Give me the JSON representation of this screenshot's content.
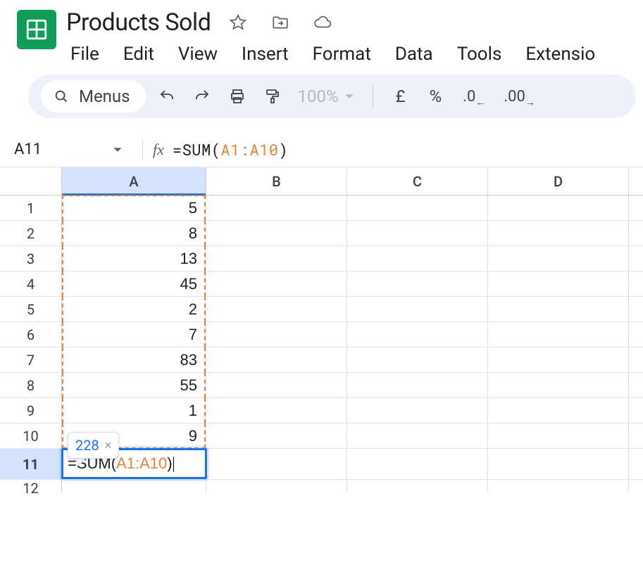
{
  "header": {
    "doc_title": "Products Sold"
  },
  "menubar": {
    "file": "File",
    "edit": "Edit",
    "view": "View",
    "insert": "Insert",
    "format": "Format",
    "data": "Data",
    "tools": "Tools",
    "extensions": "Extensio"
  },
  "toolbar": {
    "search_label": "Menus",
    "zoom": "100%",
    "currency": "£",
    "percent": "%",
    "dec_decrease": ".0",
    "dec_increase": ".00"
  },
  "formula_bar": {
    "cell_ref": "A11",
    "fx_label": "fx",
    "prefix": "=SUM(",
    "range": "A1:A10",
    "suffix": ")"
  },
  "columns": [
    "A",
    "B",
    "C",
    "D"
  ],
  "rows": {
    "1": "5",
    "2": "8",
    "3": "13",
    "4": "45",
    "5": "2",
    "6": "7",
    "7": "83",
    "8": "55",
    "9": "1",
    "10": "9"
  },
  "active_cell": {
    "row_label": "11",
    "prefix": "=SUM(",
    "range": "A1:A10",
    "suffix": ")"
  },
  "tooltip": {
    "value": "228",
    "close": "×"
  },
  "partial_row": "12"
}
